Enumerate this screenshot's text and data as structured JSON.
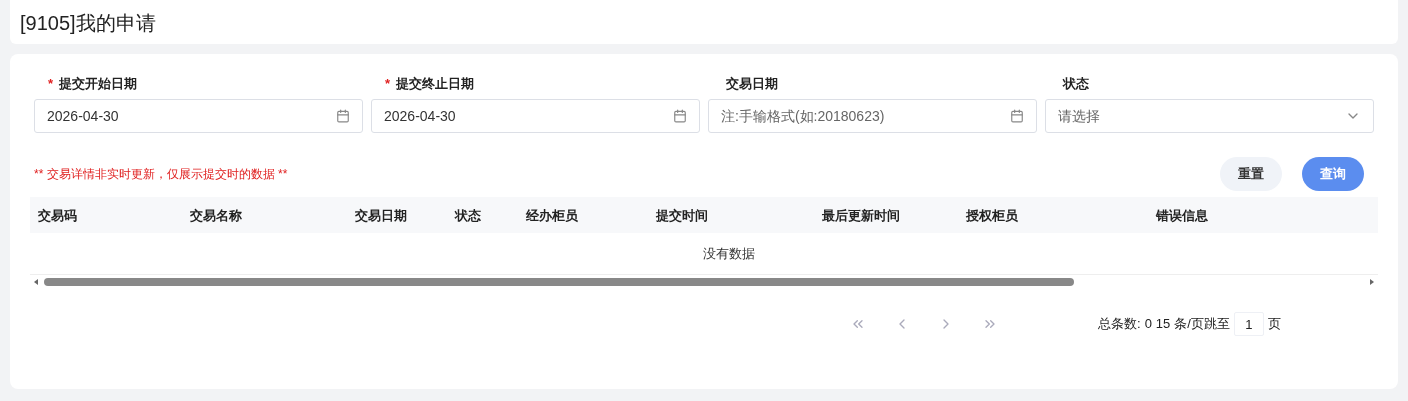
{
  "page_title": "[9105]我的申请",
  "fields": [
    {
      "kind": "date",
      "label": "提交开始日期",
      "required_mark": "*",
      "value": "2026-04-30"
    },
    {
      "kind": "date",
      "label": "提交终止日期",
      "required_mark": "*",
      "value": "2026-04-30"
    },
    {
      "kind": "date",
      "label": "交易日期",
      "placeholder": "注:手输格式(如:20180623)"
    },
    {
      "kind": "select",
      "label": "状态",
      "placeholder": "请选择"
    }
  ],
  "notice": "** 交易详情非实时更新，仅展示提交时的数据 **",
  "buttons": [
    {
      "kind": "secondary",
      "label": "重置"
    },
    {
      "kind": "primary",
      "label": "查询"
    }
  ],
  "table": {
    "columns": [
      "交易码",
      "交易名称",
      "交易日期",
      "状态",
      "经办柜员",
      "提交时间",
      "最后更新时间",
      "授权柜员",
      "错误信息"
    ],
    "empty_text": "没有数据"
  },
  "pagination": {
    "total_label": "总条数:",
    "total": "0",
    "page_size": "15",
    "page_size_label": "条/页跳至",
    "page": "1",
    "page_label": "页"
  }
}
